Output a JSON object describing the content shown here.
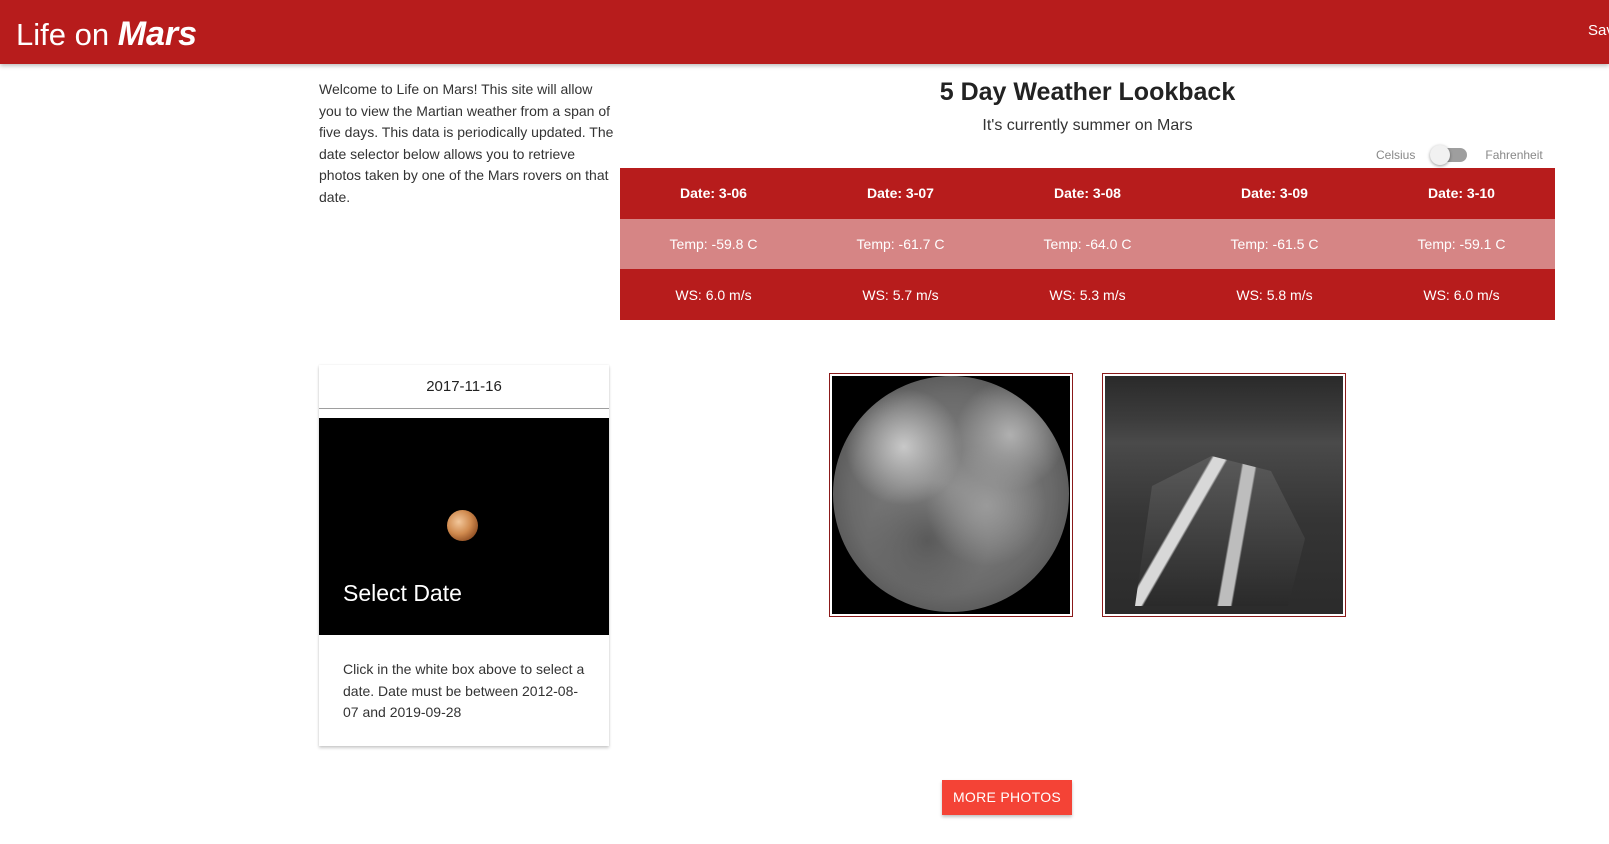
{
  "header": {
    "brand_light": "Life on ",
    "brand_bold": "Mars",
    "nav_right": "Save"
  },
  "intro": {
    "text": "Welcome to Life on Mars! This site will allow you to view the Martian weather from a span of five days. This data is periodically updated. The date selector below allows you to retrieve photos taken by one of the Mars rovers on that date."
  },
  "weather": {
    "title": "5 Day Weather Lookback",
    "subtitle": "It's currently summer on Mars",
    "toggle": {
      "left_label": "Celsius",
      "right_label": "Fahrenheit",
      "selected": "Celsius"
    },
    "dates": [
      "Date: 3-06",
      "Date: 3-07",
      "Date: 3-08",
      "Date: 3-09",
      "Date: 3-10"
    ],
    "temps": [
      "Temp: -59.8 C",
      "Temp: -61.7 C",
      "Temp: -64.0 C",
      "Temp: -61.5 C",
      "Temp: -59.1 C"
    ],
    "wind": [
      "WS: 6.0 m/s",
      "WS: 5.7 m/s",
      "WS: 5.3 m/s",
      "WS: 5.8 m/s",
      "WS: 6.0 m/s"
    ]
  },
  "date_card": {
    "date_value": "2017-11-16",
    "title": "Select Date",
    "content": "Click in the white box above to select a date. Date must be between 2012-08-07 and 2019-09-28"
  },
  "photos": {
    "more_label": "MORE PHOTOS"
  },
  "colors": {
    "primary": "#b71c1c",
    "temp_row": "#d68585",
    "button": "#f44336"
  }
}
